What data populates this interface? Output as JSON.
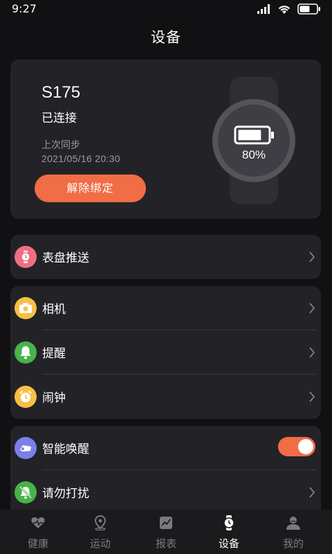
{
  "status_bar": {
    "time": "9:27"
  },
  "header": {
    "title": "设备"
  },
  "device": {
    "name": "S175",
    "status": "已连接",
    "sync_label": "上次同步",
    "sync_time": "2021/05/16   20:30",
    "unbind_label": "解除绑定",
    "battery_percent": "80%",
    "battery_level": 0.8
  },
  "groups": {
    "watchface": {
      "label": "表盘推送",
      "icon": "watch-icon",
      "color": "#f06e82"
    },
    "camera": {
      "label": "相机",
      "icon": "camera-icon",
      "color": "#f6c046"
    },
    "reminder": {
      "label": "提醒",
      "icon": "bell-icon",
      "color": "#47b34a"
    },
    "alarm": {
      "label": "闹钟",
      "icon": "alarm-clock-icon",
      "color": "#f6c046"
    },
    "smart_wake": {
      "label": "智能唤醒",
      "icon": "wake-icon",
      "color": "#7d7fe8",
      "enabled": true
    },
    "dnd": {
      "label": "请勿打扰",
      "icon": "bell-off-icon",
      "color": "#47b34a"
    }
  },
  "tabs": [
    {
      "label": "健康",
      "icon": "heart-pulse-icon",
      "active": false
    },
    {
      "label": "运动",
      "icon": "location-icon",
      "active": false
    },
    {
      "label": "报表",
      "icon": "chart-icon",
      "active": false
    },
    {
      "label": "设备",
      "icon": "watch-icon",
      "active": true
    },
    {
      "label": "我的",
      "icon": "person-icon",
      "active": false
    }
  ],
  "colors": {
    "accent": "#f16d46",
    "card": "#232327",
    "background": "#111113"
  }
}
